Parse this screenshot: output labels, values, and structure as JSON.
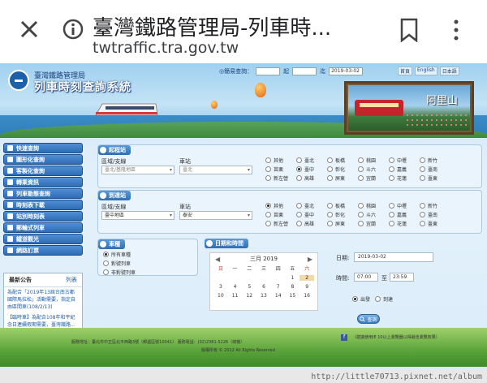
{
  "browser": {
    "title": "臺灣鐵路管理局-列車時...",
    "url": "twtraffic.tra.gov.tw",
    "icons": [
      "close-icon",
      "info-icon",
      "bookmark-icon",
      "more-icon"
    ]
  },
  "header": {
    "org_name": "臺灣鐵路管理局",
    "system_name": "列車時刻查詢系統",
    "quick_label": "◎簡易查詢：",
    "quick_from": "起",
    "quick_to": "迄",
    "quick_date": "2019-03-02",
    "links": [
      "首頁",
      "English",
      "日本語"
    ],
    "board_caption": "阿里山"
  },
  "sidebar": {
    "items": [
      {
        "label": "快速查詢",
        "icon": "search-icon"
      },
      {
        "label": "圖形化查詢",
        "icon": "chart-icon"
      },
      {
        "label": "客製化查詢",
        "icon": "settings-icon"
      },
      {
        "label": "轉乘資訊",
        "icon": "transfer-icon"
      },
      {
        "label": "列車動態查詢",
        "icon": "train-icon"
      },
      {
        "label": "時刻表下載",
        "icon": "download-icon"
      },
      {
        "label": "站別時刻表",
        "icon": "station-icon"
      },
      {
        "label": "郵輪式列車",
        "icon": "ship-icon"
      },
      {
        "label": "鐵道觀光",
        "icon": "landscape-icon"
      },
      {
        "label": "網路訂票",
        "icon": "ticket-icon"
      }
    ]
  },
  "news": {
    "title": "最新公告",
    "list_link": "列表",
    "items": [
      {
        "text": "為配合「2019年13屆台南古都國際馬拉松」活動需要，指定自由區間車(108/2/13)"
      },
      {
        "text": "【臨時車】為配合108年和平紀念日連續假期需要，臺灣鐵路..."
      }
    ]
  },
  "origin": {
    "title": "起程站",
    "region_label": "區域/支線",
    "region_value": "臺北/基隆地區",
    "station_label": "車站",
    "station_value": "臺北",
    "stations": [
      {
        "name": "其他",
        "selected": false
      },
      {
        "name": "臺北",
        "selected": false
      },
      {
        "name": "板橋",
        "selected": false
      },
      {
        "name": "桃園",
        "selected": false
      },
      {
        "name": "中壢",
        "selected": false
      },
      {
        "name": "新竹",
        "selected": false
      },
      {
        "name": "苗栗",
        "selected": false
      },
      {
        "name": "臺中",
        "selected": true
      },
      {
        "name": "彰化",
        "selected": false
      },
      {
        "name": "斗六",
        "selected": false
      },
      {
        "name": "嘉義",
        "selected": false
      },
      {
        "name": "臺南",
        "selected": false
      },
      {
        "name": "新左營",
        "selected": false
      },
      {
        "name": "高雄",
        "selected": false
      },
      {
        "name": "屏東",
        "selected": false
      },
      {
        "name": "宜蘭",
        "selected": false
      },
      {
        "name": "花蓮",
        "selected": false
      },
      {
        "name": "臺東",
        "selected": false
      }
    ]
  },
  "destination": {
    "title": "到達站",
    "region_label": "區域/支線",
    "region_value": "臺中地區",
    "station_label": "車站",
    "station_value": "泰安",
    "stations": [
      {
        "name": "其他",
        "selected": true
      },
      {
        "name": "臺北",
        "selected": false
      },
      {
        "name": "板橋",
        "selected": false
      },
      {
        "name": "桃園",
        "selected": false
      },
      {
        "name": "中壢",
        "selected": false
      },
      {
        "name": "新竹",
        "selected": false
      },
      {
        "name": "苗栗",
        "selected": false
      },
      {
        "name": "臺中",
        "selected": false
      },
      {
        "name": "彰化",
        "selected": false
      },
      {
        "name": "斗六",
        "selected": false
      },
      {
        "name": "嘉義",
        "selected": false
      },
      {
        "name": "臺南",
        "selected": false
      },
      {
        "name": "新左營",
        "selected": false
      },
      {
        "name": "高雄",
        "selected": false
      },
      {
        "name": "屏東",
        "selected": false
      },
      {
        "name": "宜蘭",
        "selected": false
      },
      {
        "name": "花蓮",
        "selected": false
      },
      {
        "name": "臺東",
        "selected": false
      }
    ]
  },
  "train_type": {
    "title": "車種",
    "options": [
      {
        "name": "所有車種",
        "selected": true
      },
      {
        "name": "對號列車",
        "selected": false
      },
      {
        "name": "非對號列車",
        "selected": false
      }
    ]
  },
  "datetime": {
    "title": "日期和時間",
    "month_title": "三月 2019",
    "prev": "◀",
    "next": "▶",
    "weekdays": [
      "日",
      "一",
      "二",
      "三",
      "四",
      "五",
      "六"
    ],
    "weeks": [
      [
        "",
        "",
        "",
        "",
        "",
        "1",
        "2"
      ],
      [
        "3",
        "4",
        "5",
        "6",
        "7",
        "8",
        "9"
      ],
      [
        "10",
        "11",
        "12",
        "13",
        "14",
        "15",
        "16"
      ]
    ],
    "date_label": "日期:",
    "date_value": "2019-03-02",
    "time_label": "時間:",
    "time_from": "07:00",
    "time_sep": "至",
    "time_to": "23:59",
    "mode_options": [
      {
        "name": "出發",
        "selected": true
      },
      {
        "name": "到達",
        "selected": false
      }
    ],
    "query_label": "查詢"
  },
  "footer": {
    "address": "服務地址：臺北市中正區北平西路3號（郵遞區號10041）   服務電話：(02)2381-5226（總機）",
    "copyright": "版權所有 © 2012 All Rights Reserved",
    "facebook": "f",
    "note": "（建議使用IE 10以上瀏覽器以得最佳瀏覽效果）"
  },
  "watermark": "http://little70713.pixnet.net/album"
}
